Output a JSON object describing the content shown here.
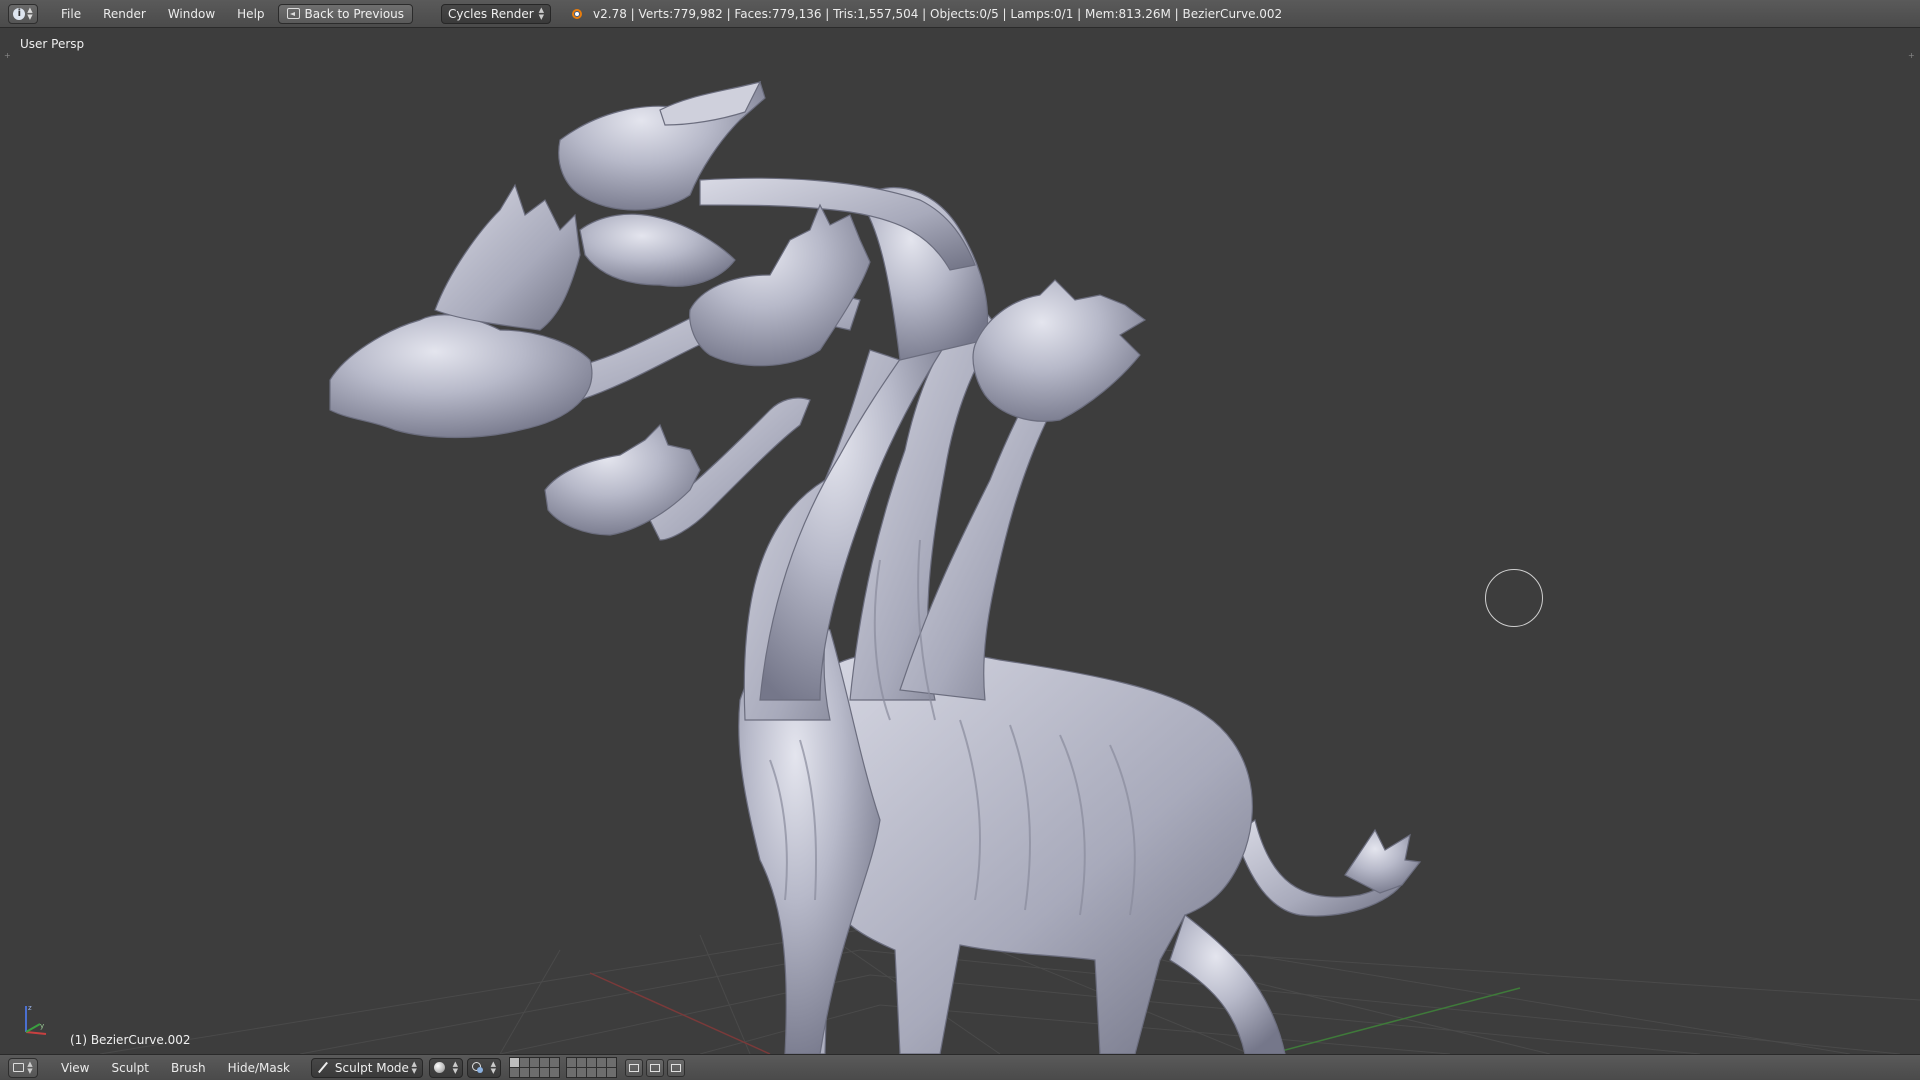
{
  "top_header": {
    "menu": [
      "File",
      "Render",
      "Window",
      "Help"
    ],
    "back_button_label": "Back to Previous",
    "render_engine": "Cycles Render",
    "stats": "v2.78 | Verts:779,982 | Faces:779,136 | Tris:1,557,504 | Objects:0/5 | Lamps:0/1 | Mem:813.26M | BezierCurve.002"
  },
  "viewport": {
    "view_label": "User Persp",
    "object_label": "(1) BezierCurve.002",
    "background_color": "#3d3d3d",
    "model_color": "#b7b9c9"
  },
  "bottom_header": {
    "menu": [
      "View",
      "Sculpt",
      "Brush",
      "Hide/Mask"
    ],
    "mode": "Sculpt Mode"
  },
  "icons": {
    "info_editor": "info-icon",
    "view3d_editor": "view3d-icon",
    "render_engine": "blender-logo-icon",
    "mode": "sculpt-brush-icon",
    "shading": "solid-sphere-icon",
    "pivot": "pivot-point-icon"
  }
}
